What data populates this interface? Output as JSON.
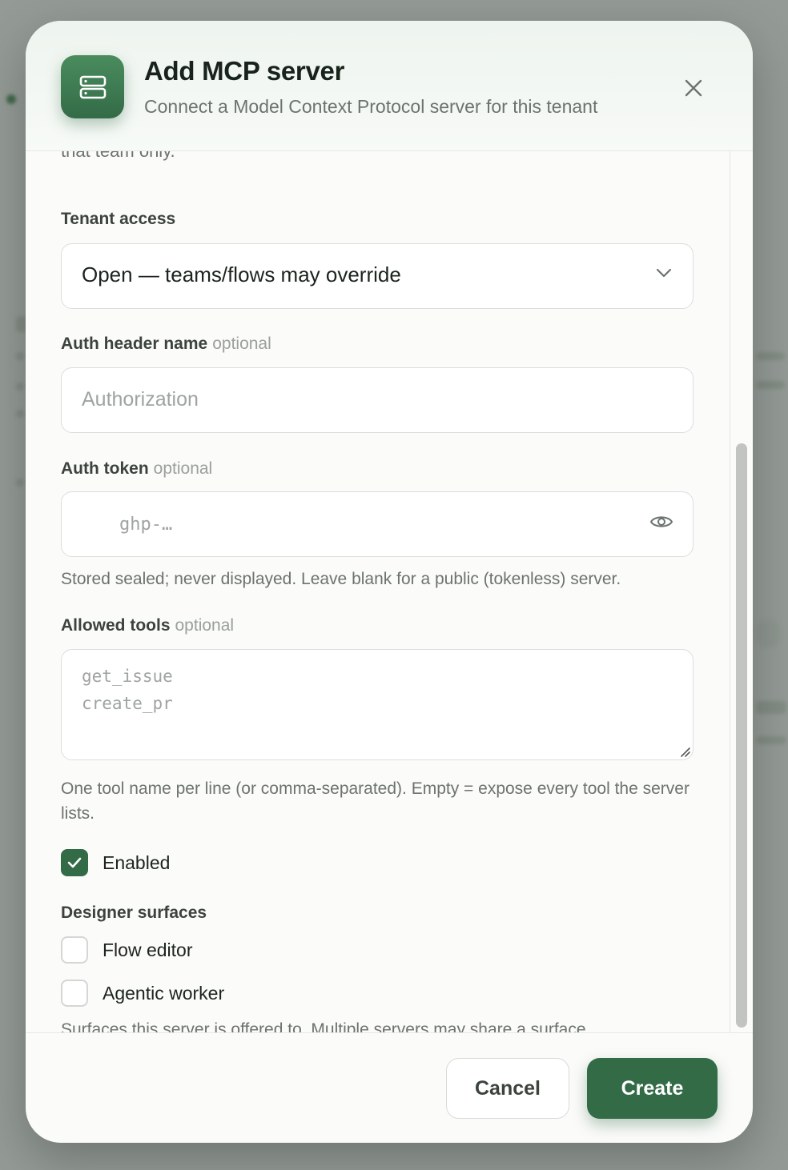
{
  "modal": {
    "title": "Add MCP server",
    "subtitle": "Connect a Model Context Protocol server for this tenant",
    "icon": "server-icon",
    "clipped_text": "that team only."
  },
  "form": {
    "tenant_access": {
      "label": "Tenant access",
      "value": "Open — teams/flows may override"
    },
    "auth_header": {
      "label": "Auth header name",
      "optional": "optional",
      "placeholder": "Authorization"
    },
    "auth_token": {
      "label": "Auth token",
      "optional": "optional",
      "placeholder": "ghp-…",
      "help": "Stored sealed; never displayed. Leave blank for a public (tokenless) server."
    },
    "allowed_tools": {
      "label": "Allowed tools",
      "optional": "optional",
      "placeholder_lines": [
        "get_issue",
        "create_pr"
      ],
      "help": "One tool name per line (or comma-separated). Empty = expose every tool the server lists."
    },
    "enabled": {
      "label": "Enabled",
      "checked": true
    },
    "designer_surfaces": {
      "label": "Designer surfaces",
      "options": [
        {
          "label": "Flow editor",
          "checked": false
        },
        {
          "label": "Agentic worker",
          "checked": false
        }
      ],
      "help": "Surfaces this server is offered to. Multiple servers may share a surface."
    }
  },
  "footer": {
    "cancel_label": "Cancel",
    "create_label": "Create"
  },
  "colors": {
    "accent": "#336b47",
    "accent_light": "#4a8c5e"
  }
}
